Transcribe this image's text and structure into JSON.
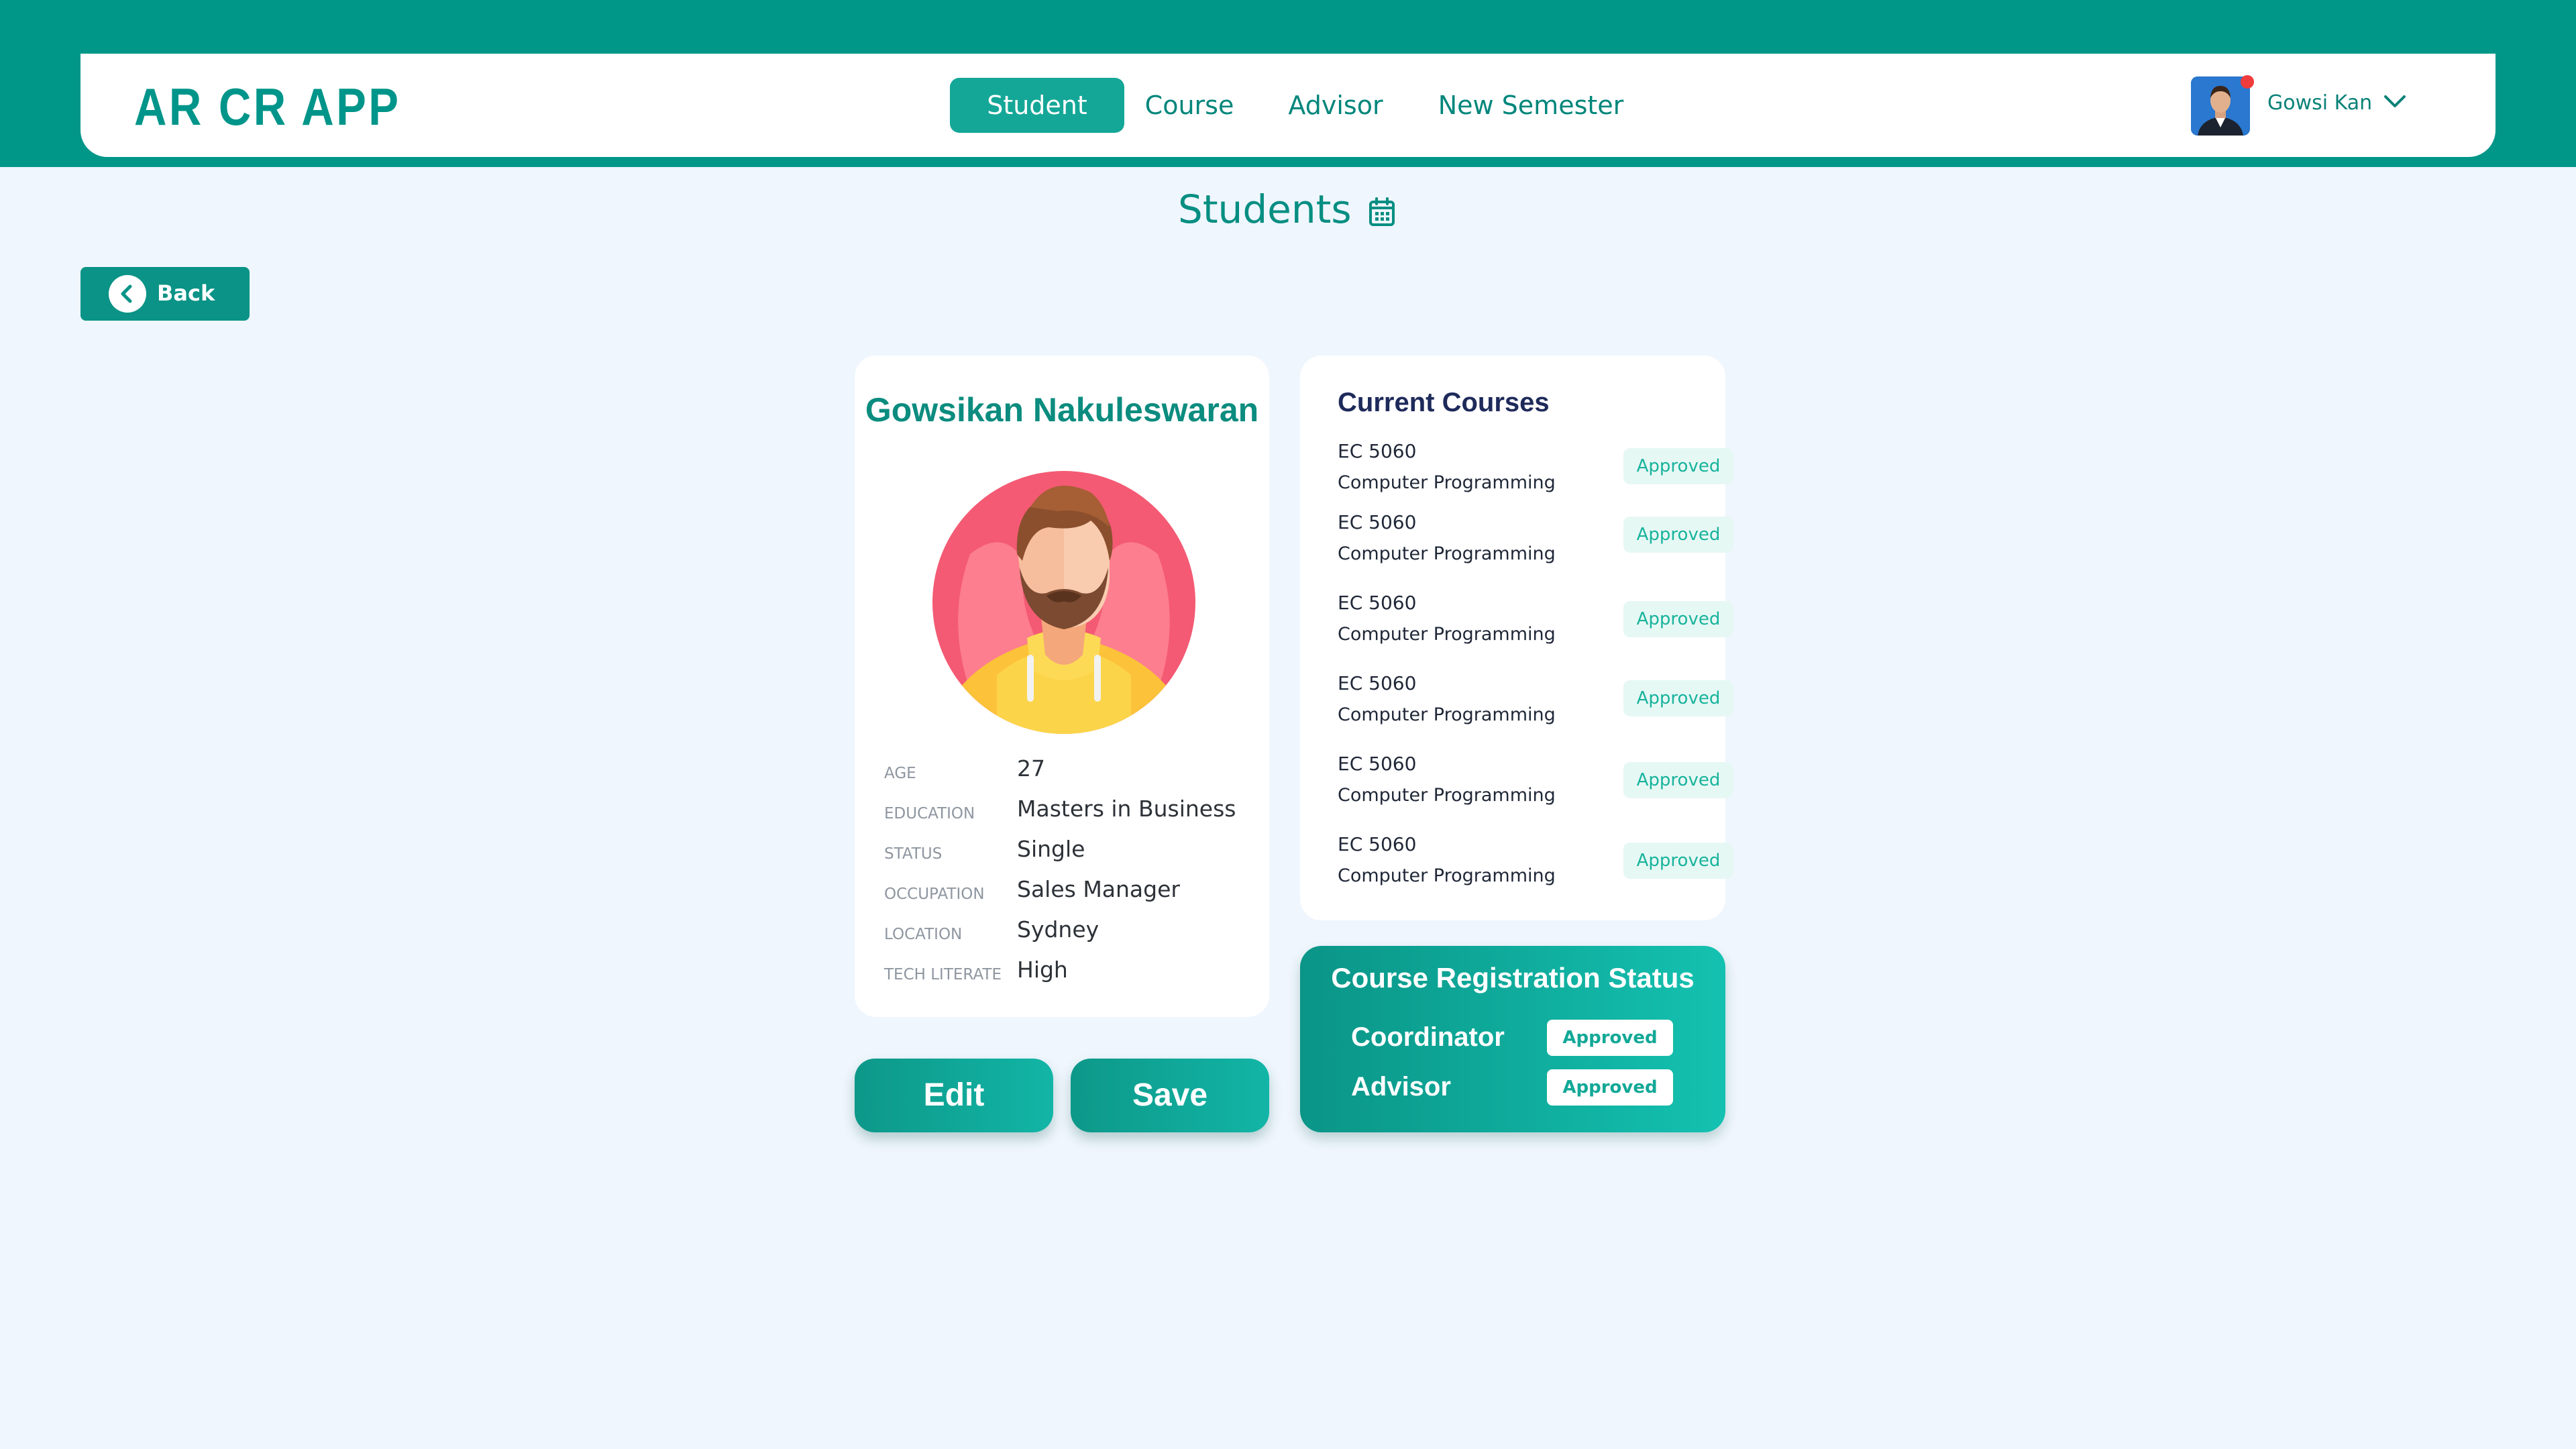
{
  "header": {
    "app_name": "AR CR APP",
    "nav": [
      {
        "label": "Student",
        "active": true
      },
      {
        "label": "Course",
        "active": false
      },
      {
        "label": "Advisor",
        "active": false
      },
      {
        "label": "New Semester",
        "active": false
      }
    ],
    "user": {
      "name": "Gowsi Kan",
      "notification_dot": true
    }
  },
  "page": {
    "title": "Students",
    "title_icon": "calendar-icon"
  },
  "back_button": {
    "label": "Back"
  },
  "student": {
    "name": "Gowsikan Nakuleswaran",
    "details": [
      {
        "key": "AGE",
        "value": "27"
      },
      {
        "key": "EDUCATION",
        "value": "Masters in Business"
      },
      {
        "key": "STATUS",
        "value": "Single"
      },
      {
        "key": "OCCUPATION",
        "value": "Sales Manager"
      },
      {
        "key": "LOCATION",
        "value": "Sydney"
      },
      {
        "key": "TECH LITERATE",
        "value": "High"
      }
    ]
  },
  "actions": {
    "edit": "Edit",
    "save": "Save"
  },
  "current_courses": {
    "title": "Current Courses",
    "items": [
      {
        "code": "EC 5060",
        "name": "Computer Programming",
        "status": "Approved"
      },
      {
        "code": "EC 5060",
        "name": "Computer Programming",
        "status": "Approved"
      },
      {
        "code": "EC 5060",
        "name": "Computer Programming",
        "status": "Approved"
      },
      {
        "code": "EC 5060",
        "name": "Computer Programming",
        "status": "Approved"
      },
      {
        "code": "EC 5060",
        "name": "Computer Programming",
        "status": "Approved"
      },
      {
        "code": "EC 5060",
        "name": "Computer Programming",
        "status": "Approved"
      }
    ]
  },
  "registration_status": {
    "title": "Course Registration Status",
    "rows": [
      {
        "label": "Coordinator",
        "status": "Approved"
      },
      {
        "label": "Advisor",
        "status": "Approved"
      }
    ]
  },
  "colors": {
    "primary": "#009688",
    "background": "#eff6fd",
    "accent": "#14a797",
    "badge_text": "#18b39c"
  }
}
